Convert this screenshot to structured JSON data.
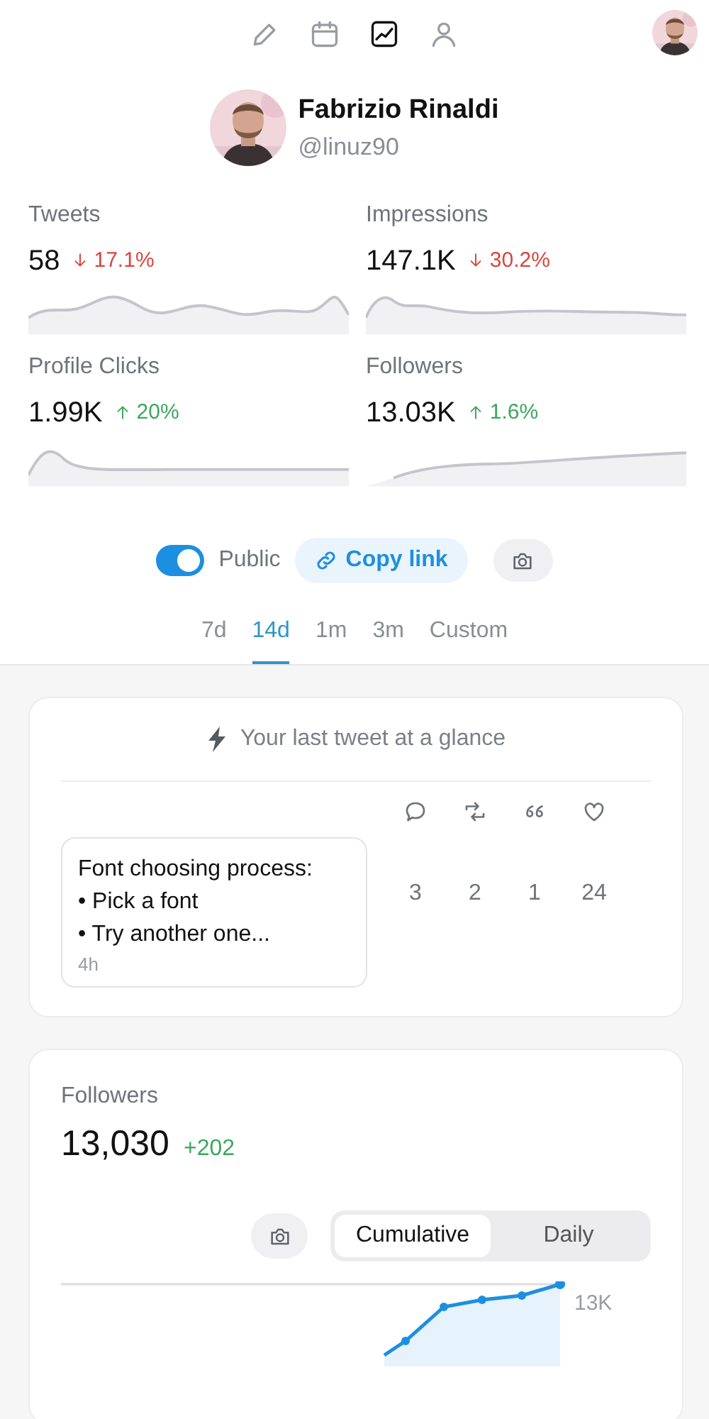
{
  "nav": [
    {
      "kind": "pencil",
      "selected": false
    },
    {
      "kind": "calendar",
      "selected": false
    },
    {
      "kind": "chart",
      "selected": true
    },
    {
      "kind": "person",
      "selected": false
    }
  ],
  "profile": {
    "name": "Fabrizio Rinaldi",
    "handle": "@linuz90"
  },
  "metrics": [
    {
      "label": "Tweets",
      "value": "58",
      "change": "17.1%",
      "kind": "down"
    },
    {
      "label": "Impressions",
      "value": "147.1K",
      "change": "30.2%",
      "kind": "down"
    },
    {
      "label": "Profile Clicks",
      "value": "1.99K",
      "change": "20%",
      "kind": "up"
    },
    {
      "label": "Followers",
      "value": "13.03K",
      "change": "1.6%",
      "kind": "up"
    }
  ],
  "sharing": {
    "toggle": {
      "label": "Public",
      "on": true
    },
    "copy_link": "Copy link"
  },
  "ranges": [
    {
      "label": "7d",
      "selected": false
    },
    {
      "label": "14d",
      "selected": true
    },
    {
      "label": "1m",
      "selected": false
    },
    {
      "label": "3m",
      "selected": false
    },
    {
      "label": "Custom",
      "selected": false
    }
  ],
  "last_tweet": {
    "title": "Your last tweet at a glance",
    "lines": [
      "Font choosing process:",
      "• Pick a font",
      "• Try another one..."
    ],
    "time": "4h",
    "stats": [
      {
        "kind": "reply",
        "count": "3"
      },
      {
        "kind": "retweet",
        "count": "2"
      },
      {
        "kind": "quote",
        "count": "1"
      },
      {
        "kind": "like",
        "count": "24"
      }
    ]
  },
  "followers_card": {
    "label": "Followers",
    "value": "13,030",
    "change": "+202",
    "modes": [
      {
        "label": "Cumulative",
        "selected": true
      },
      {
        "label": "Daily",
        "selected": false
      }
    ],
    "axis_label": "13K"
  }
}
